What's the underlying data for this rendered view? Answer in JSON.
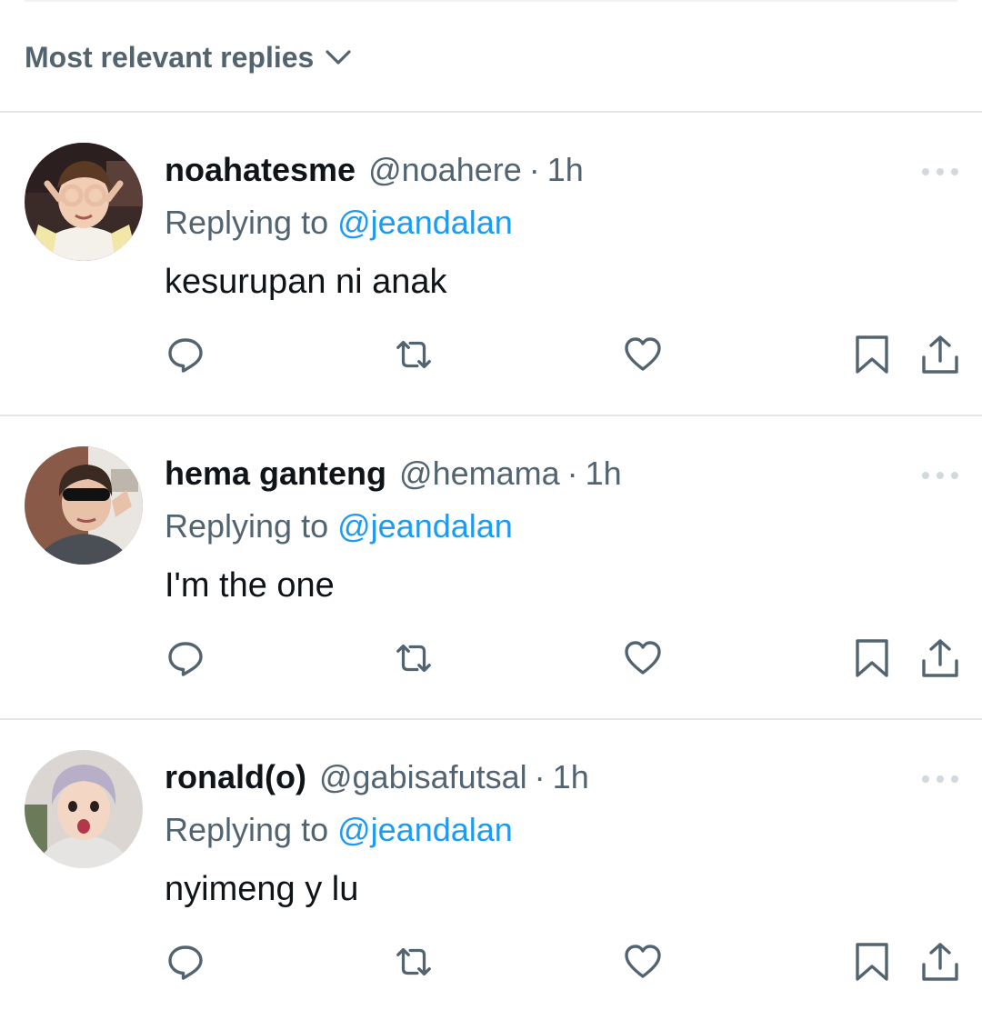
{
  "sort": {
    "label": "Most relevant replies",
    "icon": "chevron-down-icon"
  },
  "colors": {
    "primary_text": "#0f1419",
    "secondary_text": "#536471",
    "link": "#1d9bf0",
    "divider": "#e1e6ea",
    "icon": "#536471"
  },
  "replies": [
    {
      "display_name": "noahatesme",
      "handle": "@noahere",
      "separator": "·",
      "time": "1h",
      "replying_label": "Replying to",
      "replying_to": "@jeandalan",
      "text": "kesurupan ni anak"
    },
    {
      "display_name": "hema ganteng",
      "handle": "@hemama",
      "separator": "·",
      "time": "1h",
      "replying_label": "Replying to",
      "replying_to": "@jeandalan",
      "text": "I'm the one"
    },
    {
      "display_name": "ronald(o)",
      "handle": "@gabisafutsal",
      "separator": "·",
      "time": "1h",
      "replying_label": "Replying to",
      "replying_to": "@jeandalan",
      "text": "nyimeng y lu"
    }
  ],
  "action_icons": [
    "reply-icon",
    "retweet-icon",
    "like-icon",
    "bookmark-icon",
    "share-icon"
  ]
}
